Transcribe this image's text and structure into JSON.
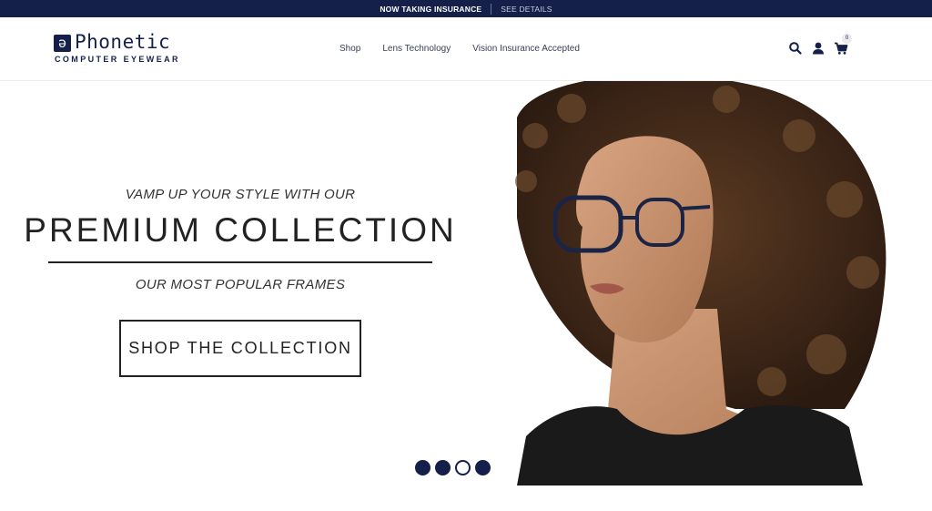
{
  "announcement": {
    "text": "NOW TAKING INSURANCE",
    "link": "SEE DETAILS"
  },
  "brand": {
    "mark": "ə",
    "name": "Phonetic",
    "tagline": "COMPUTER EYEWEAR",
    "color": "#15204a"
  },
  "nav": {
    "items": [
      {
        "label": "Shop"
      },
      {
        "label": "Lens Technology"
      },
      {
        "label": "Vision Insurance Accepted"
      }
    ]
  },
  "header_icons": {
    "search": "search-icon",
    "account": "user-icon",
    "cart": "cart-icon",
    "cart_count": "0"
  },
  "hero": {
    "eyebrow": "VAMP UP YOUR STYLE WITH OUR",
    "headline": "PREMIUM COLLECTION",
    "subline": "OUR MOST POPULAR FRAMES",
    "cta": "SHOP THE COLLECTION",
    "slides_total": 4,
    "active_slide": 3
  }
}
